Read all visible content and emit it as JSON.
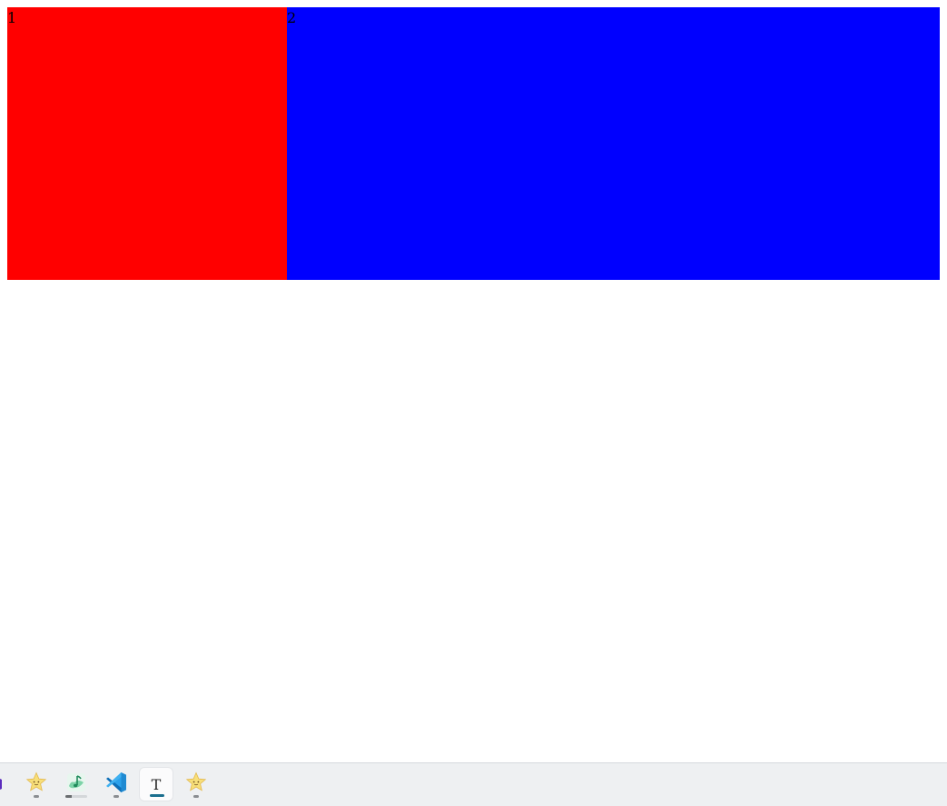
{
  "boxes": [
    {
      "label": "1",
      "color": "#ff0000"
    },
    {
      "label": "2",
      "color": "#0000ff"
    }
  ],
  "taskbar": {
    "apps": [
      {
        "name": "partial-app",
        "icon": "purple-app-icon"
      },
      {
        "name": "star-app",
        "icon": "star-face-icon",
        "state": "running"
      },
      {
        "name": "music-app",
        "icon": "music-note-icon",
        "state": "running",
        "progress": 0.3
      },
      {
        "name": "vscode",
        "icon": "vscode-icon",
        "state": "running"
      },
      {
        "name": "typora",
        "icon": "typora-icon",
        "glyph": "T",
        "state": "active"
      },
      {
        "name": "star-app-2",
        "icon": "star-face-icon",
        "state": "running"
      }
    ]
  }
}
